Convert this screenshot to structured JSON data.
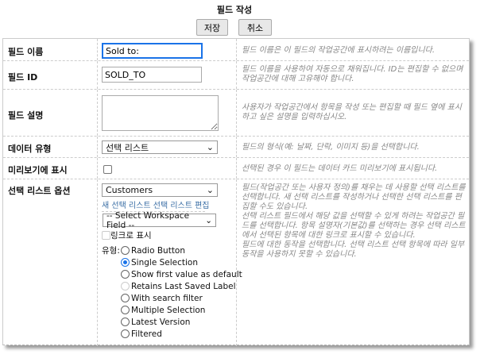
{
  "title": "필드 작성",
  "buttons": {
    "save": "저장",
    "cancel": "취소"
  },
  "rows": {
    "name": {
      "label": "필드 이름",
      "value": "Sold to:",
      "help": "필드 이름은 이 필드의 작업공간에 표시하려는 이름입니다."
    },
    "id": {
      "label": "필드 ID",
      "value": "SOLD_TO",
      "help": "필드 이름을 사용하여 자동으로 채워집니다. ID는 편집할 수 없으며 작업공간에 대해 고유해야 합니다."
    },
    "desc": {
      "label": "필드 설명",
      "value": "",
      "help": "사용자가 작업공간에서 항목을 작성 또는 편집할 때 필드 옆에 표시하고 싶은 설명을 입력하십시오."
    },
    "type": {
      "label": "데이터 유형",
      "value": "선택 리스트",
      "help": "필드의 형식(예: 날짜, 단락, 이미지 등)을 선택합니다."
    },
    "preview": {
      "label": "미리보기에 표시",
      "help": "선택된 경우 이 필드는 데이터 카드 미리보기에 표시됩니다."
    },
    "options": {
      "label": "선택 리스트 옵션",
      "list_value": "Customers",
      "link_new": "새 선택 리스트",
      "link_edit": "선택 리스트 편집",
      "workspace_field": "-- Select Workspace Field --",
      "show_as_link": "링크로 표시",
      "type_label": "유형:",
      "radios": [
        {
          "label": "Radio Button",
          "state": "off"
        },
        {
          "label": "Single Selection",
          "state": "on"
        },
        {
          "label": "Show first value as default",
          "state": "off"
        },
        {
          "label": "Retains Last Saved Label",
          "state": "disabled"
        },
        {
          "label": "With search filter",
          "state": "off"
        },
        {
          "label": "Multiple Selection",
          "state": "off"
        },
        {
          "label": "Latest Version",
          "state": "off"
        },
        {
          "label": "Filtered",
          "state": "off"
        }
      ],
      "help1": "필드(작업공간 또는 사용자 정의)를 채우는 데 사용할 선택 리스트를 선택합니다. 새 선택 리스트를 작성하거나 선택한 선택 리스트를 편집할 수도 있습니다.",
      "help2": "선택 리스트 필드에서 해당 값을 선택할 수 있게 하려는 작업공간 필드를 선택합니다. 항목 설명자(기본값)를 선택하는 경우 선택 리스트에서 선택된 항목에 대한 링크로 표시할 수 있습니다.",
      "help3": "필드에 대한 동작을 선택합니다. 선택 리스트 선택 항목에 따라 일부 동작을 사용하지 못할 수 있습니다."
    }
  }
}
